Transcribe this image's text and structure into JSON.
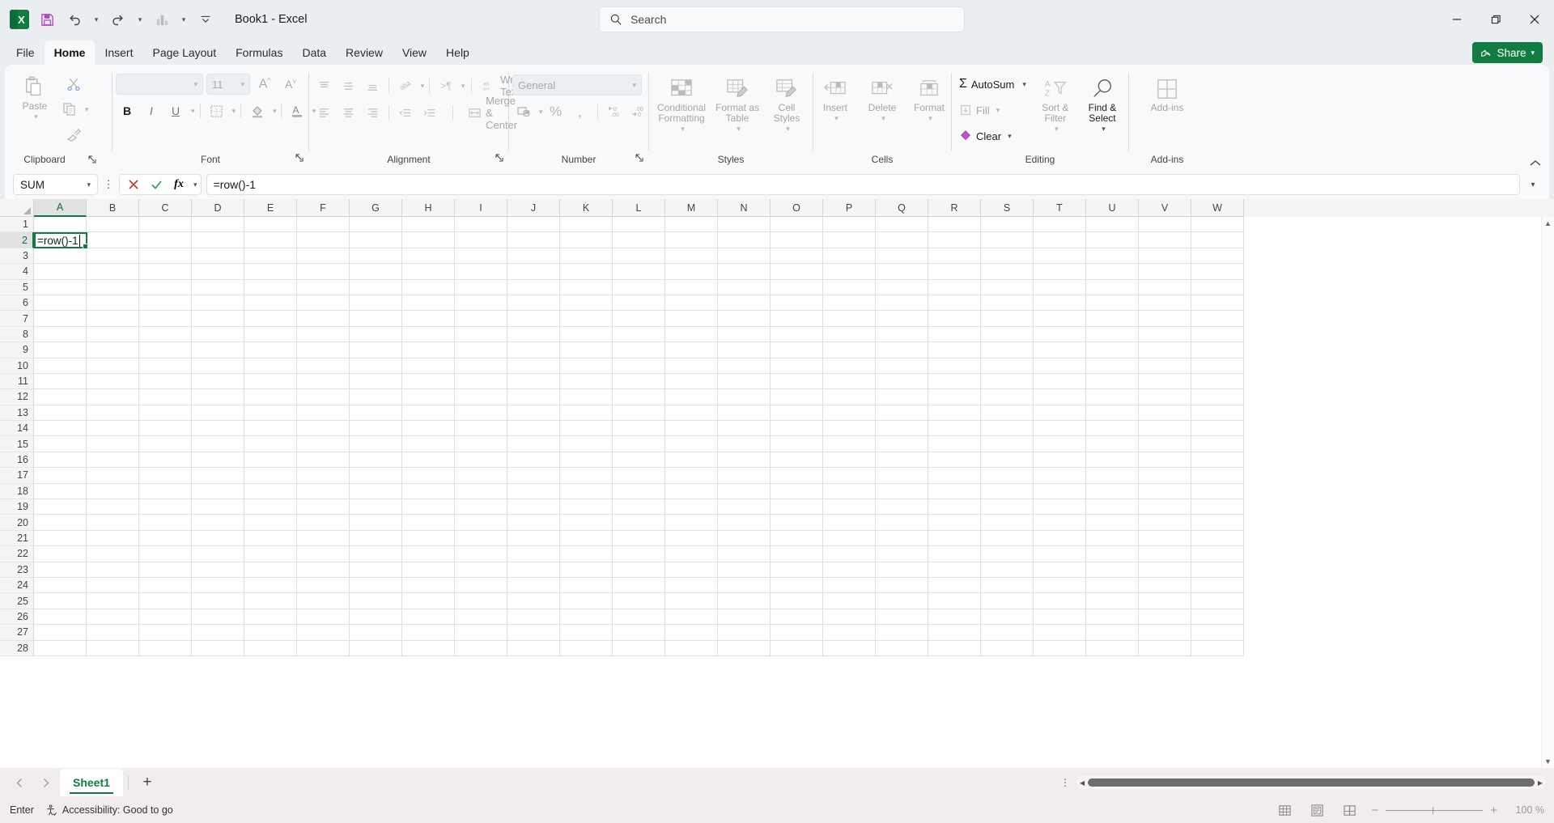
{
  "titlebar": {
    "app_icon": "excel-logo",
    "document_title": "Book1  -  Excel",
    "qat": [
      {
        "name": "save-button",
        "icon": "save-icon"
      },
      {
        "name": "undo-button",
        "icon": "undo-icon"
      },
      {
        "name": "redo-button",
        "icon": "redo-icon"
      },
      {
        "name": "chart-button",
        "icon": "chart-icon"
      },
      {
        "name": "customize-qat-button",
        "icon": "chevron-down-bar-icon"
      }
    ],
    "search": {
      "placeholder": "Search",
      "icon": "search-icon"
    },
    "window": {
      "minimize": "minimize-icon",
      "restore": "restore-icon",
      "close": "close-icon"
    }
  },
  "ribbon_tabs": [
    {
      "label": "File",
      "active": false
    },
    {
      "label": "Home",
      "active": true
    },
    {
      "label": "Insert",
      "active": false
    },
    {
      "label": "Page Layout",
      "active": false
    },
    {
      "label": "Formulas",
      "active": false
    },
    {
      "label": "Data",
      "active": false
    },
    {
      "label": "Review",
      "active": false
    },
    {
      "label": "View",
      "active": false
    },
    {
      "label": "Help",
      "active": false
    }
  ],
  "share": {
    "label": "Share",
    "icon": "share-icon",
    "color": "#107c41"
  },
  "ribbon": {
    "collapse_icon": "chevron-up-icon",
    "groups": [
      {
        "name": "clipboard",
        "label": "Clipboard",
        "dialog_launcher": true,
        "items": [
          {
            "label": "Paste",
            "name": "paste-button",
            "icon": "paste-icon",
            "disabled": true
          },
          {
            "label": "Cut",
            "name": "cut-button",
            "icon": "scissors-icon",
            "disabled": true
          },
          {
            "label": "Copy",
            "name": "copy-button",
            "icon": "copy-icon",
            "disabled": true
          },
          {
            "label": "Format Painter",
            "name": "format-painter-button",
            "icon": "paintbrush-icon",
            "disabled": true
          }
        ]
      },
      {
        "name": "font",
        "label": "Font",
        "dialog_launcher": true,
        "font_name": "",
        "font_size": "11",
        "items": [
          {
            "label": "Increase Font Size",
            "name": "increase-font-size-button",
            "icon": "a-up-icon"
          },
          {
            "label": "Decrease Font Size",
            "name": "decrease-font-size-button",
            "icon": "a-down-icon"
          },
          {
            "label": "Bold",
            "name": "bold-button",
            "icon": "bold-icon"
          },
          {
            "label": "Italic",
            "name": "italic-button",
            "icon": "italic-icon"
          },
          {
            "label": "Underline",
            "name": "underline-button",
            "icon": "underline-icon"
          },
          {
            "label": "Borders",
            "name": "borders-button",
            "icon": "borders-icon"
          },
          {
            "label": "Fill Color",
            "name": "fill-color-button",
            "icon": "fill-color-icon"
          },
          {
            "label": "Font Color",
            "name": "font-color-button",
            "icon": "font-color-icon"
          }
        ]
      },
      {
        "name": "alignment",
        "label": "Alignment",
        "dialog_launcher": true,
        "wrap_text": "Wrap Text",
        "merge_center": "Merge & Center",
        "items": [
          {
            "label": "Top Align",
            "name": "top-align-button",
            "icon": "align-top-icon"
          },
          {
            "label": "Middle Align",
            "name": "middle-align-button",
            "icon": "align-middle-icon"
          },
          {
            "label": "Bottom Align",
            "name": "bottom-align-button",
            "icon": "align-bottom-icon"
          },
          {
            "label": "Orientation",
            "name": "orientation-button",
            "icon": "orientation-icon"
          },
          {
            "label": "Text Direction",
            "name": "text-direction-button",
            "icon": "text-direction-icon"
          },
          {
            "label": "Align Left",
            "name": "align-left-button",
            "icon": "align-left-icon"
          },
          {
            "label": "Center",
            "name": "align-center-button",
            "icon": "align-center-icon"
          },
          {
            "label": "Align Right",
            "name": "align-right-button",
            "icon": "align-right-icon"
          },
          {
            "label": "Decrease Indent",
            "name": "decrease-indent-button",
            "icon": "decrease-indent-icon"
          },
          {
            "label": "Increase Indent",
            "name": "increase-indent-button",
            "icon": "increase-indent-icon"
          }
        ]
      },
      {
        "name": "number",
        "label": "Number",
        "dialog_launcher": true,
        "number_format": "General",
        "items": [
          {
            "label": "Accounting Number Format",
            "name": "accounting-format-button",
            "icon": "currency-icon"
          },
          {
            "label": "Percent Style",
            "name": "percent-style-button",
            "icon": "percent-icon"
          },
          {
            "label": "Comma Style",
            "name": "comma-style-button",
            "icon": "comma-icon"
          },
          {
            "label": "Increase Decimal",
            "name": "increase-decimal-button",
            "icon": "increase-decimal-icon"
          },
          {
            "label": "Decrease Decimal",
            "name": "decrease-decimal-button",
            "icon": "decrease-decimal-icon"
          }
        ]
      },
      {
        "name": "styles",
        "label": "Styles",
        "items": [
          {
            "label": "Conditional Formatting",
            "name": "conditional-formatting-button",
            "icon": "conditional-formatting-icon",
            "disabled": true
          },
          {
            "label": "Format as Table",
            "name": "format-as-table-button",
            "icon": "format-as-table-icon",
            "disabled": true
          },
          {
            "label": "Cell Styles",
            "name": "cell-styles-button",
            "icon": "cell-styles-icon",
            "disabled": true
          }
        ]
      },
      {
        "name": "cells",
        "label": "Cells",
        "items": [
          {
            "label": "Insert",
            "name": "insert-cells-button",
            "icon": "insert-cells-icon",
            "disabled": true
          },
          {
            "label": "Delete",
            "name": "delete-cells-button",
            "icon": "delete-cells-icon",
            "disabled": true
          },
          {
            "label": "Format",
            "name": "format-cells-button",
            "icon": "format-cells-icon",
            "disabled": true
          }
        ]
      },
      {
        "name": "editing",
        "label": "Editing",
        "items": [
          {
            "label": "AutoSum",
            "name": "autosum-button",
            "icon": "sigma-icon",
            "disabled": false
          },
          {
            "label": "Fill",
            "name": "fill-button",
            "icon": "fill-down-icon",
            "disabled": true
          },
          {
            "label": "Clear",
            "name": "clear-button",
            "icon": "eraser-icon",
            "disabled": false
          },
          {
            "label": "Sort & Filter",
            "name": "sort-filter-button",
            "icon": "sort-filter-icon",
            "disabled": true
          },
          {
            "label": "Find & Select",
            "name": "find-select-button",
            "icon": "magnifier-icon",
            "disabled": false
          }
        ]
      },
      {
        "name": "addins",
        "label": "Add-ins",
        "items": [
          {
            "label": "Add-ins",
            "name": "addins-button",
            "icon": "addins-grid-icon",
            "disabled": true
          }
        ]
      }
    ]
  },
  "formula_bar": {
    "name_box_value": "SUM",
    "name_box_caret": "chevron-down-icon",
    "cancel": {
      "name": "cancel-formula-button",
      "icon": "x-icon",
      "color": "#d93025"
    },
    "enter": {
      "name": "enter-formula-button",
      "icon": "check-icon",
      "color": "#107c41"
    },
    "insert_function": {
      "name": "insert-function-button",
      "icon": "fx-icon"
    },
    "formula_value": "=row()-1",
    "expand_icon": "chevron-down-icon"
  },
  "grid": {
    "columns": [
      "A",
      "B",
      "C",
      "D",
      "E",
      "F",
      "G",
      "H",
      "I",
      "J",
      "K",
      "L",
      "M",
      "N",
      "O",
      "P",
      "Q",
      "R",
      "S",
      "T",
      "U",
      "V",
      "W"
    ],
    "rows": [
      1,
      2,
      3,
      4,
      5,
      6,
      7,
      8,
      9,
      10,
      11,
      12,
      13,
      14,
      15,
      16,
      17,
      18,
      19,
      20,
      21,
      22,
      23,
      24,
      25,
      26,
      27,
      28
    ],
    "selected_column": "A",
    "selected_row": 2,
    "active_cell": "A2",
    "editing": true,
    "cell_edit_text": "=row()-1"
  },
  "sheet_bar": {
    "prev": {
      "name": "previous-sheet-button",
      "icon": "chevron-left-icon"
    },
    "next": {
      "name": "next-sheet-button",
      "icon": "chevron-right-icon"
    },
    "tabs": [
      {
        "label": "Sheet1",
        "active": true
      }
    ],
    "add": {
      "name": "new-sheet-button",
      "icon": "plus-icon"
    }
  },
  "status_bar": {
    "mode": "Enter",
    "accessibility": "Accessibility: Good to go",
    "accessibility_icon": "accessibility-icon",
    "views": [
      {
        "name": "normal-view-button",
        "icon": "normal-view-icon",
        "active": true
      },
      {
        "name": "page-layout-view-button",
        "icon": "page-layout-view-icon",
        "active": false
      },
      {
        "name": "page-break-view-button",
        "icon": "page-break-view-icon",
        "active": false
      }
    ],
    "zoom_out": "minus-icon",
    "zoom_in": "plus-icon",
    "zoom_level": "100 %"
  }
}
